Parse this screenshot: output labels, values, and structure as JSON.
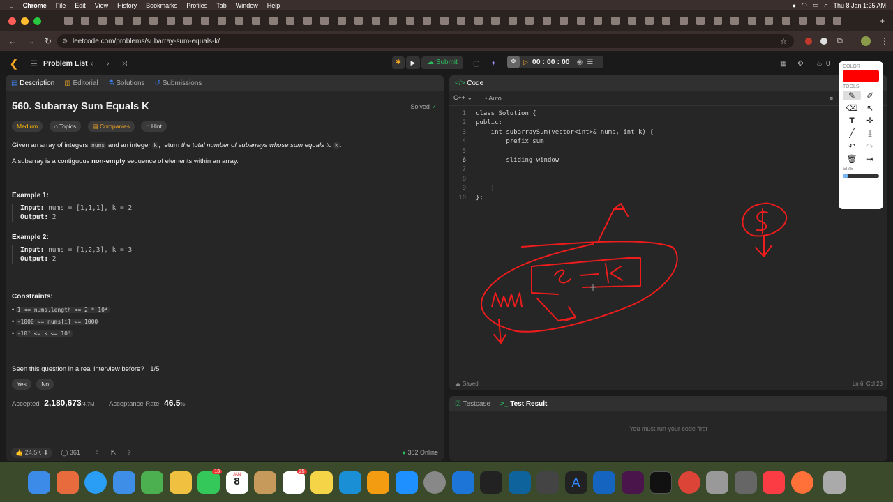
{
  "menubar": {
    "app": "Chrome",
    "items": [
      "File",
      "Edit",
      "View",
      "History",
      "Bookmarks",
      "Profiles",
      "Tab",
      "Window",
      "Help"
    ],
    "clock": "Thu 8 Jan  1:25 AM"
  },
  "browser": {
    "url": "leetcode.com/problems/subarray-sum-equals-k/"
  },
  "lc_header": {
    "problem_list": "Problem List",
    "submit": "Submit",
    "timer": "00 : 00 : 00",
    "streak": "0"
  },
  "left_tabs": [
    "Description",
    "Editorial",
    "Solutions",
    "Submissions"
  ],
  "problem": {
    "title": "560. Subarray Sum Equals K",
    "status": "Solved",
    "difficulty": "Medium",
    "tags": [
      "Topics",
      "Companies",
      "Hint"
    ],
    "desc_1": "Given an array of integers",
    "code_nums": "nums",
    "desc_2": "and an integer",
    "code_k": "k",
    "desc_3": ", return",
    "desc_4": "the total number of subarrays whose sum equals to",
    "desc_5": ".",
    "desc_p2_a": "A subarray is a contiguous",
    "desc_p2_b": "non-empty",
    "desc_p2_c": "sequence of elements within an array.",
    "ex1_title": "Example 1:",
    "ex1_input_label": "Input:",
    "ex1_input": "nums = [1,1,1], k = 2",
    "ex1_output_label": "Output:",
    "ex1_output": "2",
    "ex2_title": "Example 2:",
    "ex2_input_label": "Input:",
    "ex2_input": "nums = [1,2,3], k = 3",
    "ex2_output_label": "Output:",
    "ex2_output": "2",
    "constraints_title": "Constraints:",
    "constraints": [
      "1 <= nums.length <= 2 * 10⁴",
      "-1000 <= nums[i] <= 1000",
      "-10⁷ <= k <= 10⁷"
    ],
    "interview_q": "Seen this question in a real interview before?",
    "interview_count": "1/5",
    "yes": "Yes",
    "no": "No",
    "accepted_label": "Accepted",
    "accepted": "2,180,673",
    "accepted_total": "/4.7M",
    "rate_label": "Acceptance Rate",
    "rate": "46.5",
    "rate_unit": "%",
    "likes": "24.5K",
    "comments": "361",
    "online": "382 Online"
  },
  "code_panel": {
    "title": "Code",
    "language": "C++",
    "mode": "Auto",
    "saved": "Saved",
    "cursor": "Ln 6, Col 23",
    "lines": [
      "class Solution {",
      "public:",
      "    int subarraySum(vector<int>& nums, int k) {",
      "        prefix sum",
      "",
      "        sliding window",
      "",
      "",
      "    }",
      "};"
    ]
  },
  "test_panel": {
    "tab1": "Testcase",
    "tab2": "Test Result",
    "message": "You must run your code first"
  },
  "draw_tool": {
    "color_label": "COLOR",
    "tools_label": "TOOLS",
    "size_label": "SIZE",
    "color": "#ff0000",
    "size": 0.15
  },
  "dock": {
    "calendar_month": "JAN",
    "calendar_day": "8",
    "badge_messages": "13",
    "badge_reminders": "25"
  }
}
